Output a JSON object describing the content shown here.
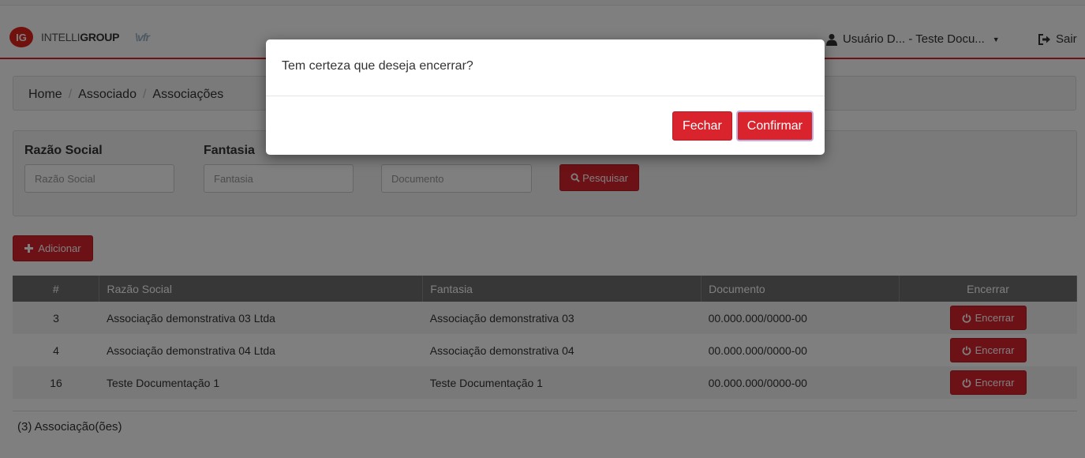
{
  "header": {
    "logo_badge": "IG",
    "logo_text_light": "INTELLI",
    "logo_text_bold": "GROUP",
    "logo_mark": "\\vfr",
    "user_label": "Usuário D... - Teste Docu...",
    "logout_label": "Sair"
  },
  "breadcrumb": [
    "Home",
    "Associado",
    "Associações"
  ],
  "filters": {
    "razao_label": "Razão Social",
    "razao_placeholder": "Razão Social",
    "fantasia_label": "Fantasia",
    "fantasia_placeholder": "Fantasia",
    "documento_placeholder": "Documento",
    "search_label": "Pesquisar"
  },
  "add_label": "Adicionar",
  "table": {
    "headers": [
      "#",
      "Razão Social",
      "Fantasia",
      "Documento",
      "Encerrar"
    ],
    "rows": [
      {
        "id": "3",
        "razao": "Associação demonstrativa 03 Ltda",
        "fantasia": "Associação demonstrativa 03",
        "documento": "00.000.000/0000-00",
        "action": "Encerrar"
      },
      {
        "id": "4",
        "razao": "Associação demonstrativa 04 Ltda",
        "fantasia": "Associação demonstrativa 04",
        "documento": "00.000.000/0000-00",
        "action": "Encerrar"
      },
      {
        "id": "16",
        "razao": "Teste Documentação 1",
        "fantasia": "Teste Documentação 1",
        "documento": "00.000.000/0000-00",
        "action": "Encerrar"
      }
    ]
  },
  "footer_count": "(3) Associação(ões)",
  "modal": {
    "message": "Tem certeza que deseja encerrar?",
    "close_label": "Fechar",
    "confirm_label": "Confirmar"
  },
  "colors": {
    "brand_red": "#d9232d",
    "table_header": "#6e6e6e",
    "overlay": "rgba(0,0,0,0.5)"
  }
}
